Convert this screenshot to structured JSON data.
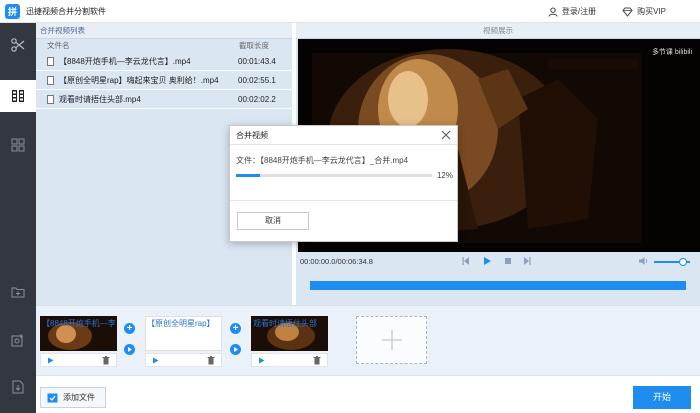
{
  "app": {
    "title": "迅捷视频合并分割软件",
    "logo_char": "拼"
  },
  "header": {
    "login_label": "登录/注册",
    "vip_label": "购买VIP"
  },
  "colors": {
    "accent": "#1f8cf0",
    "sidebar_bg": "#33373f",
    "panel_bg": "#dbe6f3"
  },
  "file_list": {
    "heading": "合并视频列表",
    "columns": [
      "文件名",
      "截取长度"
    ],
    "rows": [
      {
        "name": "【8848开炮手机—李云龙代言】.mp4",
        "duration": "00:01:43.4"
      },
      {
        "name": "【原创全明星rap】嗨起来宝贝 奥利给！.mp4",
        "duration": "00:02:55.1"
      },
      {
        "name": "观看时请捂住头部.mp4",
        "duration": "00:02:02.2"
      }
    ]
  },
  "preview": {
    "heading": "视频展示",
    "watermark": "多节课 bilibili",
    "timecode": "00:00:00.0/00:06:34.8",
    "volume_level": 0.8
  },
  "dialog": {
    "title": "合并视频",
    "file_label": "文件：【8848开炮手机—李云龙代言】_合并.mp4",
    "progress_percent": 12,
    "progress_text": "12%",
    "cancel_label": "取消"
  },
  "timeline": {
    "clips": [
      {
        "label": "【8848开炮手机—李",
        "thumb": "dark"
      },
      {
        "label": "【原创全明星rap】",
        "thumb": "white"
      },
      {
        "label": "观看时请捂住头部",
        "thumb": "dark"
      }
    ]
  },
  "footer": {
    "add_file_label": "添加文件",
    "start_label": "开始"
  }
}
